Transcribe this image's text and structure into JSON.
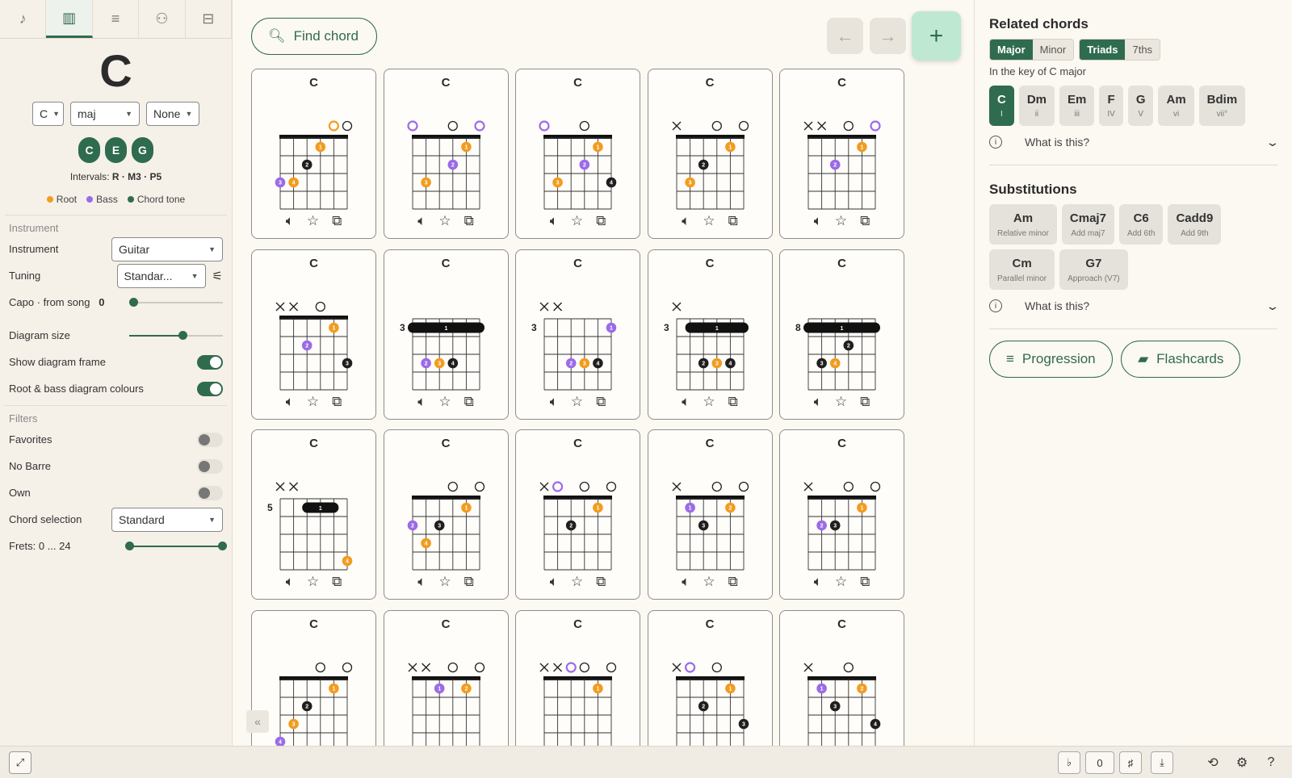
{
  "left": {
    "tabs": [
      "♪",
      "▥",
      "≡",
      "⚇",
      "⊟"
    ],
    "chord_name": "C",
    "root_select": "C",
    "quality_select": "maj",
    "bass_select": "None",
    "notes": [
      "C",
      "E",
      "G"
    ],
    "intervals_label": "Intervals:",
    "intervals_value": "R · M3 · P5",
    "legend": {
      "root": "Root",
      "bass": "Bass",
      "tone": "Chord tone"
    },
    "instrument_section": "Instrument",
    "instrument_label": "Instrument",
    "instrument_value": "Guitar",
    "tuning_label": "Tuning",
    "tuning_value": "Standar...",
    "capo_label": "Capo · from song",
    "capo_value": "0",
    "diagram_size_label": "Diagram size",
    "diagram_size_level": 0.57,
    "show_frame_label": "Show diagram frame",
    "root_bass_label": "Root & bass diagram colours",
    "filters_section": "Filters",
    "favorites_label": "Favorites",
    "nobarre_label": "No Barre",
    "own_label": "Own",
    "chord_selection_label": "Chord selection",
    "chord_selection_value": "Standard",
    "frets_label": "Frets: 0 ... 24"
  },
  "center": {
    "find_label": "Find chord",
    "chords": [
      {
        "name": "C",
        "base": "",
        "top": [
          "",
          "",
          "",
          "",
          "R",
          "O"
        ],
        "notes": [
          "G",
          "C",
          "E",
          "G",
          "C",
          "E"
        ],
        "dots": [
          [
            4,
            1,
            "1",
            "r"
          ],
          [
            3,
            2,
            "2",
            "c"
          ],
          [
            2,
            3,
            "4",
            "r"
          ],
          [
            1,
            3,
            "3",
            "b"
          ]
        ]
      },
      {
        "name": "C",
        "base": "",
        "top": [
          "B",
          "",
          "",
          "O",
          "",
          "B"
        ],
        "notes": [
          "E",
          "C",
          "E",
          "G",
          "C",
          "E"
        ],
        "dots": [
          [
            5,
            1,
            "1",
            "r"
          ],
          [
            4,
            2,
            "2",
            "b"
          ],
          [
            2,
            3,
            "3",
            "r"
          ]
        ]
      },
      {
        "name": "C",
        "base": "",
        "top": [
          "B",
          "",
          "",
          "O",
          "",
          ""
        ],
        "notes": [
          "E",
          "C",
          "E",
          "G",
          "C",
          "G"
        ],
        "dots": [
          [
            5,
            1,
            "1",
            "r"
          ],
          [
            4,
            2,
            "2",
            "b"
          ],
          [
            2,
            3,
            "3",
            "r"
          ],
          [
            6,
            3,
            "4",
            "c"
          ]
        ]
      },
      {
        "name": "C",
        "base": "",
        "top": [
          "X",
          "",
          "",
          "O",
          "",
          "O"
        ],
        "notes": [
          "",
          "C",
          "E",
          "G",
          "C",
          "E"
        ],
        "dots": [
          [
            5,
            1,
            "1",
            "r"
          ],
          [
            3,
            2,
            "2",
            "c"
          ],
          [
            2,
            3,
            "3",
            "r"
          ]
        ]
      },
      {
        "name": "C",
        "base": "",
        "top": [
          "X",
          "X",
          "",
          "O",
          "",
          "B"
        ],
        "notes": [
          "",
          "",
          "E",
          "G",
          "C",
          "E"
        ],
        "dots": [
          [
            5,
            1,
            "1",
            "r"
          ],
          [
            3,
            2,
            "2",
            "b"
          ]
        ]
      },
      {
        "name": "C",
        "base": "",
        "top": [
          "X",
          "X",
          "",
          "O",
          "",
          ""
        ],
        "notes": [
          "",
          "",
          "E",
          "G",
          "C",
          "G"
        ],
        "dots": [
          [
            5,
            1,
            "1",
            "r"
          ],
          [
            3,
            2,
            "2",
            "b"
          ],
          [
            6,
            3,
            "3",
            "c"
          ]
        ]
      },
      {
        "name": "C",
        "base": "3",
        "top": [
          "",
          "",
          "",
          "",
          "",
          ""
        ],
        "notes": [
          "G",
          "C",
          "G",
          "C",
          "E",
          "G"
        ],
        "dots": [
          [
            2,
            3,
            "2",
            "b"
          ],
          [
            3,
            3,
            "3",
            "r"
          ],
          [
            4,
            3,
            "4",
            "c"
          ]
        ],
        "barre": [
          1,
          6
        ]
      },
      {
        "name": "C",
        "base": "3",
        "top": [
          "X",
          "X",
          "",
          "",
          "",
          ""
        ],
        "notes": [
          "",
          "",
          "G",
          "C",
          "E",
          "G"
        ],
        "dots": [
          [
            3,
            3,
            "2",
            "b"
          ],
          [
            4,
            3,
            "3",
            "r"
          ],
          [
            5,
            3,
            "4",
            "c"
          ],
          [
            6,
            1,
            "1",
            "b"
          ]
        ]
      },
      {
        "name": "C",
        "base": "3",
        "top": [
          "X",
          "",
          "",
          "",
          "",
          ""
        ],
        "notes": [
          "",
          "C",
          "G",
          "C",
          "E",
          "G"
        ],
        "dots": [
          [
            3,
            3,
            "2",
            "c"
          ],
          [
            4,
            3,
            "3",
            "r"
          ],
          [
            5,
            3,
            "4",
            "c"
          ]
        ],
        "barre": [
          2,
          6
        ]
      },
      {
        "name": "C",
        "base": "8",
        "top": [
          "",
          "",
          "",
          "",
          "",
          ""
        ],
        "notes": [
          "C",
          "G",
          "C",
          "E",
          "G",
          "C"
        ],
        "dots": [
          [
            4,
            2,
            "2",
            "c"
          ],
          [
            2,
            3,
            "3",
            "c"
          ],
          [
            3,
            3,
            "4",
            "r"
          ]
        ],
        "barre": [
          1,
          6
        ]
      },
      {
        "name": "C",
        "base": "5",
        "top": [
          "X",
          "X",
          "",
          "",
          "",
          ""
        ],
        "notes": [
          "",
          "",
          "G",
          "C",
          "E",
          "C"
        ],
        "dots": [
          [
            6,
            4,
            "4",
            "r"
          ]
        ],
        "barre": [
          3,
          5
        ]
      },
      {
        "name": "C",
        "base": "",
        "top": [
          "",
          "",
          "",
          "O",
          "",
          "O"
        ],
        "notes": [
          "F#",
          "C",
          "E",
          "G",
          "C",
          "E"
        ],
        "dots": [
          [
            5,
            1,
            "1",
            "r"
          ],
          [
            1,
            2,
            "2",
            "b"
          ],
          [
            3,
            2,
            "3",
            "c"
          ],
          [
            2,
            3,
            "4",
            "r"
          ]
        ]
      },
      {
        "name": "C",
        "base": "",
        "top": [
          "X",
          "B",
          "",
          "O",
          "",
          "O"
        ],
        "notes": [
          "",
          "A",
          "E",
          "G",
          "C",
          "E"
        ],
        "dots": [
          [
            5,
            1,
            "1",
            "r"
          ],
          [
            3,
            2,
            "2",
            "c"
          ]
        ]
      },
      {
        "name": "C",
        "base": "",
        "top": [
          "X",
          "",
          "",
          "O",
          "",
          "O"
        ],
        "notes": [
          "",
          "A#",
          "E",
          "G",
          "C",
          "E"
        ],
        "dots": [
          [
            2,
            1,
            "1",
            "b"
          ],
          [
            5,
            1,
            "2",
            "r"
          ],
          [
            3,
            2,
            "3",
            "c"
          ]
        ]
      },
      {
        "name": "C",
        "base": "",
        "top": [
          "X",
          "",
          "",
          "O",
          "",
          "O"
        ],
        "notes": [
          "",
          "B",
          "E",
          "G",
          "C",
          "E"
        ],
        "dots": [
          [
            5,
            1,
            "1",
            "r"
          ],
          [
            2,
            2,
            "2",
            "b"
          ],
          [
            3,
            2,
            "3",
            "c"
          ]
        ]
      },
      {
        "name": "C",
        "base": "",
        "top": [
          "",
          "",
          "",
          "O",
          "",
          "O"
        ],
        "notes": [
          "G#",
          "C",
          "E",
          "G",
          "C",
          "E"
        ],
        "dots": [
          [
            5,
            1,
            "1",
            "r"
          ],
          [
            3,
            2,
            "2",
            "c"
          ],
          [
            2,
            3,
            "3",
            "r"
          ],
          [
            1,
            4,
            "4",
            "b"
          ]
        ]
      },
      {
        "name": "C",
        "base": "",
        "top": [
          "X",
          "X",
          "",
          "O",
          "",
          "O"
        ],
        "notes": [
          "",
          "",
          "D#",
          "G",
          "C",
          "E"
        ],
        "dots": [
          [
            3,
            1,
            "1",
            "b"
          ],
          [
            5,
            1,
            "2",
            "r"
          ]
        ]
      },
      {
        "name": "C",
        "base": "",
        "top": [
          "X",
          "X",
          "B",
          "O",
          "",
          "O"
        ],
        "notes": [
          "",
          "",
          "D",
          "G",
          "C",
          "E"
        ],
        "dots": [
          [
            5,
            1,
            "1",
            "r"
          ]
        ]
      },
      {
        "name": "C",
        "base": "",
        "top": [
          "X",
          "B",
          "",
          "O",
          "",
          ""
        ],
        "notes": [
          "",
          "A",
          "E",
          "G",
          "C",
          "G"
        ],
        "dots": [
          [
            5,
            1,
            "1",
            "r"
          ],
          [
            3,
            2,
            "2",
            "c"
          ],
          [
            6,
            3,
            "3",
            "c"
          ]
        ]
      },
      {
        "name": "C",
        "base": "",
        "top": [
          "X",
          "",
          "",
          "O",
          "",
          ""
        ],
        "notes": [
          "",
          "A#",
          "E",
          "G",
          "C",
          "G"
        ],
        "dots": [
          [
            2,
            1,
            "1",
            "b"
          ],
          [
            5,
            1,
            "2",
            "r"
          ],
          [
            3,
            2,
            "3",
            "c"
          ],
          [
            6,
            3,
            "4",
            "c"
          ]
        ]
      }
    ]
  },
  "right": {
    "related_title": "Related chords",
    "seg1": [
      "Major",
      "Minor"
    ],
    "seg2": [
      "Triads",
      "7ths"
    ],
    "key_text": "In the key of C major",
    "key_chords": [
      [
        "C",
        "I"
      ],
      [
        "Dm",
        "ii"
      ],
      [
        "Em",
        "iii"
      ],
      [
        "F",
        "IV"
      ],
      [
        "G",
        "V"
      ],
      [
        "Am",
        "vi"
      ],
      [
        "Bdim",
        "vii°"
      ]
    ],
    "what_label": "What is this?",
    "subs_title": "Substitutions",
    "subs": [
      [
        "Am",
        "Relative minor"
      ],
      [
        "Cmaj7",
        "Add maj7"
      ],
      [
        "C6",
        "Add 6th"
      ],
      [
        "Cadd9",
        "Add 9th"
      ],
      [
        "Cm",
        "Parallel minor"
      ],
      [
        "G7",
        "Approach (V7)"
      ]
    ],
    "progression_label": "Progression",
    "flashcards_label": "Flashcards"
  },
  "bottom": {
    "flat": "♭",
    "transpose": "0",
    "sharp": "♯"
  },
  "colors": {
    "accent": "#2f6b4f",
    "root": "#f29c1f",
    "bass": "#9b6be8",
    "tone": "#1f1f1f"
  }
}
